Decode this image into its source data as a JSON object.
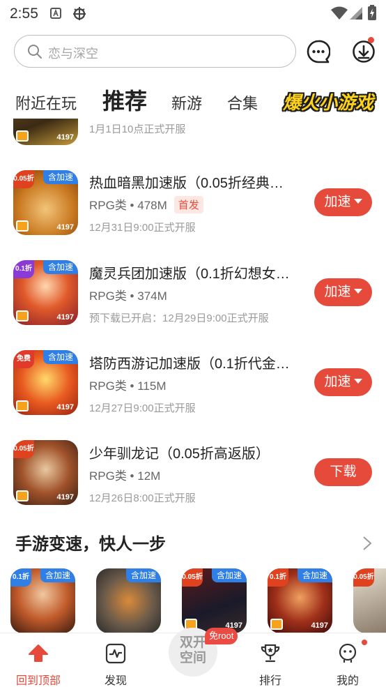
{
  "status_bar": {
    "time": "2:55"
  },
  "search": {
    "placeholder": "恋与深空"
  },
  "tabs": [
    {
      "label": "附近在玩"
    },
    {
      "label": "推荐"
    },
    {
      "label": "新游"
    },
    {
      "label": "合集"
    },
    {
      "label": "爆火小游戏"
    }
  ],
  "games": [
    {
      "title": "",
      "date": "1月1日10点正式开服",
      "button": "",
      "thumb_num": "4197"
    },
    {
      "title": "热血暗黑加速版（0.05折经典…",
      "meta": "RPG类 • 478M",
      "badge": "首发",
      "date": "12月31日9:00正式开服",
      "button": "加速",
      "corner": "0.05折",
      "tag": "含加速",
      "thumb_num": "4197"
    },
    {
      "title": "魔灵兵团加速版（0.1折幻想女…",
      "meta": "RPG类 • 374M",
      "date": "预下载已开启：12月29日9:00正式开服",
      "button": "加速",
      "corner": "0.1折",
      "tag": "含加速",
      "thumb_num": "4197"
    },
    {
      "title": "塔防西游记加速版（0.1折代金…",
      "meta": "RPG类 • 115M",
      "date": "12月27日9:00正式开服",
      "button": "加速",
      "corner": "免费",
      "tag": "含加速",
      "thumb_num": "4197"
    },
    {
      "title": "少年驯龙记（0.05折高返版）",
      "meta": "RPG类 • 12M",
      "date": "12月26日8:00正式开服",
      "button": "下载",
      "corner": "0.05折",
      "thumb_num": "4197"
    }
  ],
  "section": {
    "title": "手游变速，快人一步",
    "thumbs": [
      {
        "corner": "0.1折",
        "tag": "含加速"
      },
      {
        "corner": "",
        "tag": "含加速"
      },
      {
        "corner": "0.05折",
        "tag": "含加速",
        "num": "4197"
      },
      {
        "corner": "0.1折",
        "tag": "含加速",
        "num": "4197"
      },
      {
        "corner": "0.05折",
        "tag": ""
      }
    ]
  },
  "bottom_nav": {
    "back_top": "回到顶部",
    "discover": "发现",
    "center_line1": "双开",
    "center_line2": "空间",
    "center_badge": "免root",
    "rank": "排行",
    "mine": "我的"
  },
  "colors": {
    "accent": "#e64a3b",
    "tag_blue": "#2f7fe6",
    "promo_yellow": "#ffd21a"
  }
}
